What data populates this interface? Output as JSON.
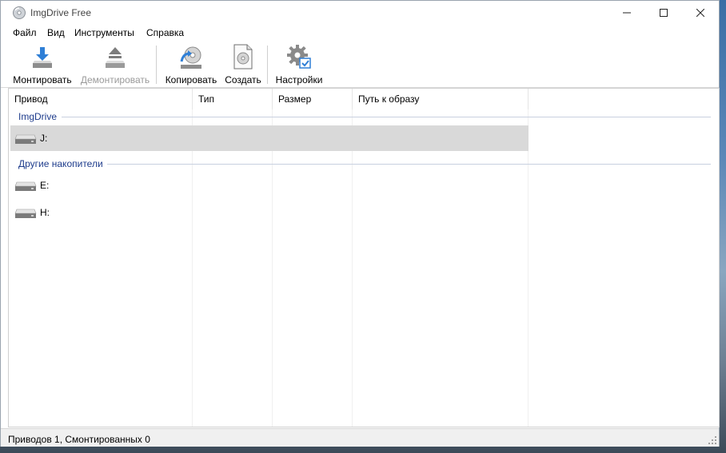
{
  "window": {
    "title": "ImgDrive Free"
  },
  "menu": [
    "Файл",
    "Вид",
    "Инструменты",
    "Справка"
  ],
  "toolbar": {
    "mount": "Монтировать",
    "unmount": "Демонтировать",
    "copy": "Копировать",
    "create": "Создать",
    "settings": "Настройки"
  },
  "columns": [
    "Привод",
    "Тип",
    "Размер",
    "Путь к образу"
  ],
  "groups": [
    {
      "label": "ImgDrive",
      "drives": [
        {
          "letter": "J:",
          "selected": true
        }
      ]
    },
    {
      "label": "Другие накопители",
      "drives": [
        {
          "letter": "E:"
        },
        {
          "letter": "H:"
        }
      ]
    }
  ],
  "status": "Приводов 1, Смонтированных 0",
  "colors": {
    "selection": "#d9d9d9",
    "group_text": "#1e3c8c",
    "disabled_text": "#9a9a9a"
  }
}
